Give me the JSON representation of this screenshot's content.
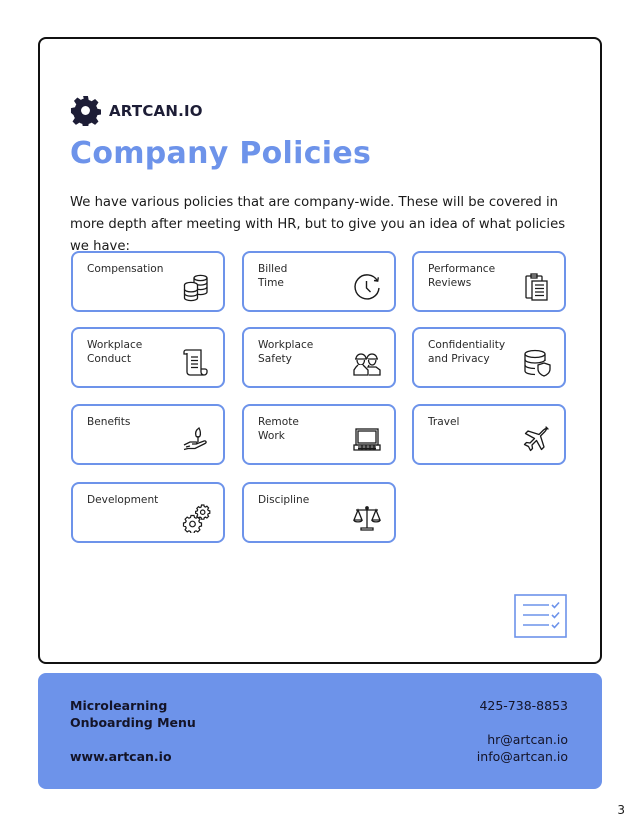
{
  "brand": {
    "name": "ARTCAN.IO",
    "icon": "gear-icon"
  },
  "page": {
    "title": "Company Policies",
    "intro": "We have various policies that are company-wide. These will be covered in more depth after meeting with HR, but to give you an idea of what policies we have:",
    "page_number": "3"
  },
  "policies": [
    {
      "label": "Compensation",
      "icon": "coins-icon"
    },
    {
      "label": "Billed\nTime",
      "icon": "clock-refresh-icon"
    },
    {
      "label": "Performance\nReviews",
      "icon": "clipboard-icon"
    },
    {
      "label": "Workplace\nConduct",
      "icon": "scroll-icon"
    },
    {
      "label": "Workplace\nSafety",
      "icon": "hard-hat-workers-icon"
    },
    {
      "label": "Confidentiality\nand Privacy",
      "icon": "database-shield-icon"
    },
    {
      "label": "Benefits",
      "icon": "hand-plant-icon"
    },
    {
      "label": "Remote\nWork",
      "icon": "laptop-icon"
    },
    {
      "label": "Travel",
      "icon": "airplane-icon"
    },
    {
      "label": "Development",
      "icon": "gears-icon"
    },
    {
      "label": "Discipline",
      "icon": "scales-icon"
    }
  ],
  "decoration": {
    "icon": "checklist-icon"
  },
  "footer": {
    "line1": "Microlearning",
    "line2": "Onboarding Menu",
    "url": "www.artcan.io",
    "phone": "425-738-8853",
    "email1": "hr@artcan.io",
    "email2": "info@artcan.io"
  },
  "colors": {
    "accent": "#6d93ea",
    "text_dark": "#1d1d36",
    "frame_border": "#111111"
  }
}
